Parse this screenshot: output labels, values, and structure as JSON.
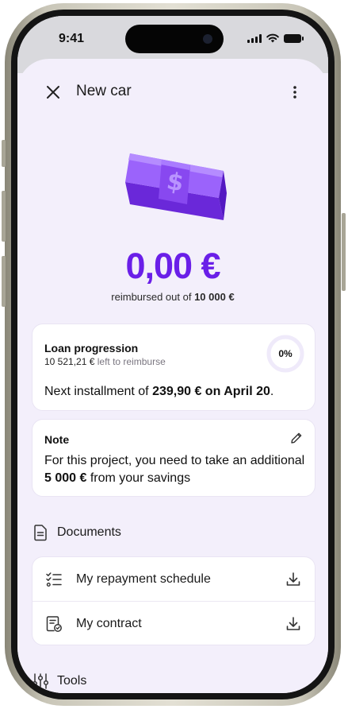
{
  "status_bar": {
    "time": "9:41",
    "icons": [
      "signal-icon",
      "wifi-icon",
      "battery-icon"
    ]
  },
  "header": {
    "title": "New car",
    "close_icon": "close-icon",
    "menu_icon": "more-vertical-icon"
  },
  "hero": {
    "illustration": "money-bill-illustration",
    "amount": "0,00 €",
    "subtitle_prefix": "reimbursed out of ",
    "subtitle_total": "10 000 €"
  },
  "loan_card": {
    "title": "Loan progression",
    "left_amount": "10 521,21 €",
    "left_suffix": " left to reimburse",
    "progress_label": "0%",
    "progress_value": 0,
    "next_prefix": "Next installment of ",
    "next_amount": "239,90 € on April 20",
    "next_suffix": "."
  },
  "note_card": {
    "title": "Note",
    "edit_icon": "pencil-icon",
    "text_prefix": "For this project, you need to take an additional ",
    "text_amount": "5 000 €",
    "text_suffix": " from your savings"
  },
  "documents": {
    "heading": "Documents",
    "items": [
      {
        "label": "My repayment schedule",
        "icon": "checklist-icon",
        "action_icon": "download-icon"
      },
      {
        "label": "My contract",
        "icon": "contract-icon",
        "action_icon": "download-icon"
      }
    ]
  },
  "tools": {
    "heading": "Tools",
    "icon": "sliders-icon"
  },
  "colors": {
    "accent": "#6a1fe8",
    "background": "#f3effb",
    "card": "#ffffff"
  }
}
